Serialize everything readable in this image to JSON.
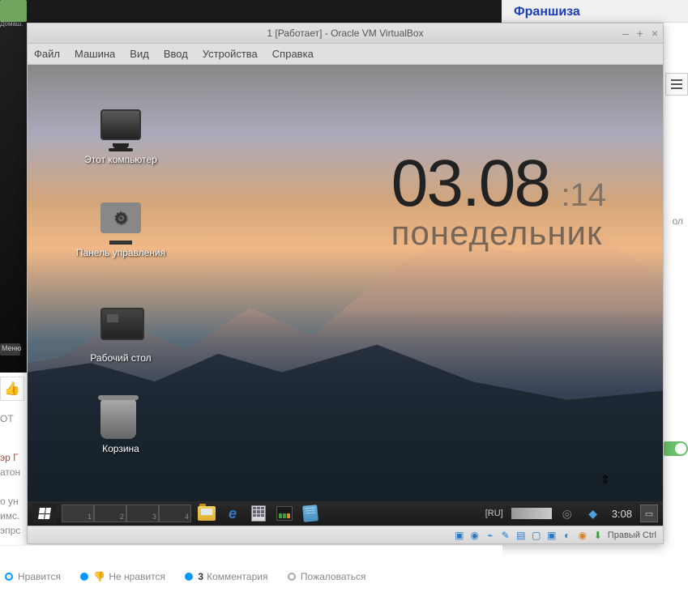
{
  "host": {
    "home_label": "Домаш.",
    "menu_label": "Меню",
    "franshiza": "Франшиза",
    "side_text": "ол"
  },
  "vbox": {
    "title": "1 [Работает] - Oracle VM VirtualBox",
    "menu": {
      "file": "Файл",
      "machine": "Машина",
      "view": "Вид",
      "input": "Ввод",
      "devices": "Устройства",
      "help": "Справка"
    },
    "statusbar": {
      "hostkey": "Правый Ctrl"
    }
  },
  "guest": {
    "clock": {
      "time": "03.08",
      "seconds": ":14",
      "day": "понедельник"
    },
    "icons": {
      "computer": "Этот компьютер",
      "control_panel": "Панель управления",
      "desktop": "Рабочий стол",
      "trash": "Корзина"
    },
    "taskbar": {
      "pagers": [
        "1",
        "2",
        "3",
        "4"
      ],
      "lang": "[RU]",
      "time": "3:08"
    }
  },
  "comments": {
    "snippet": [
      "ОТ",
      "эр Г",
      "атон",
      "о ун",
      "имс.",
      "эпрс"
    ],
    "like": "Нравится",
    "dislike": "Не нравится",
    "count": "3",
    "comment_label": "Комментария",
    "report": "Пожаловаться"
  }
}
